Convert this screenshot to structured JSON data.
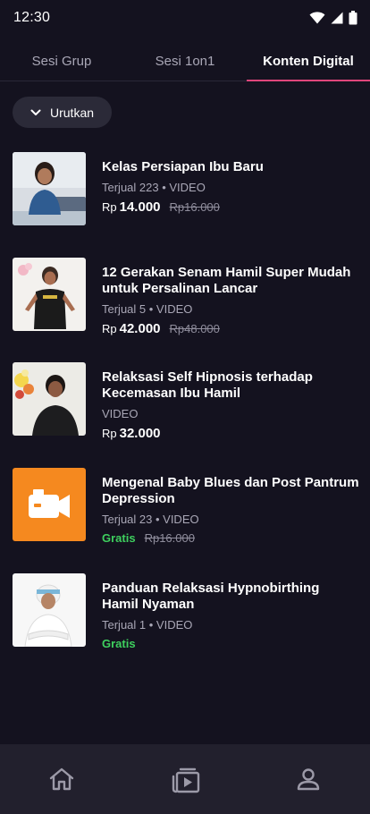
{
  "status_bar": {
    "time": "12:30"
  },
  "tabs": [
    {
      "label": "Sesi Grup"
    },
    {
      "label": "Sesi 1on1"
    },
    {
      "label": "Konten Digital",
      "active": true
    }
  ],
  "sort": {
    "label": "Urutkan"
  },
  "items": [
    {
      "title": "Kelas Persiapan Ibu Baru",
      "meta": "Terjual 223 • VIDEO",
      "currency": "Rp",
      "price": "14.000",
      "old_price": "Rp16.000"
    },
    {
      "title": "12 Gerakan Senam Hamil Super Mudah untuk Persalinan Lancar",
      "meta": "Terjual 5 • VIDEO",
      "currency": "Rp",
      "price": "42.000",
      "old_price": "Rp48.000"
    },
    {
      "title": "Relaksasi Self Hipnosis terhadap Kecemasan Ibu Hamil",
      "meta": "VIDEO",
      "currency": "Rp",
      "price": "32.000"
    },
    {
      "title": "Mengenal Baby Blues dan Post Pantrum Depression",
      "meta": "Terjual 23 • VIDEO",
      "free_label": "Gratis",
      "old_price": "Rp16.000",
      "thumb_color": "#f5891f"
    },
    {
      "title": "Panduan Relaksasi Hypnobirthing Hamil Nyaman",
      "meta": "Terjual 1 • VIDEO",
      "free_label": "Gratis"
    }
  ],
  "bottom_nav": [
    {
      "icon": "home-icon"
    },
    {
      "icon": "video-library-icon"
    },
    {
      "icon": "profile-icon"
    }
  ],
  "colors": {
    "background": "#14121f",
    "accent": "#e0457b",
    "free": "#3ecf5e",
    "nav_background": "#22202d"
  }
}
